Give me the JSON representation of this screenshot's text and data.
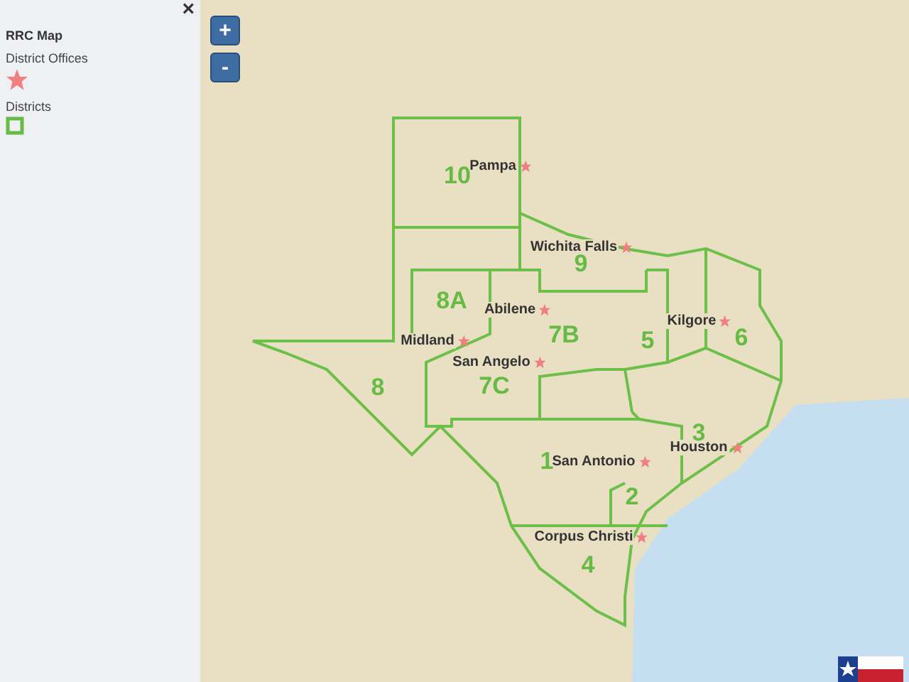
{
  "legend": {
    "close": "×",
    "title": "RRC Map",
    "items": [
      {
        "kind": "star",
        "label": "District Offices"
      },
      {
        "kind": "square",
        "label": "Districts"
      }
    ]
  },
  "zoom": {
    "in": "+",
    "out": "-"
  },
  "map": {
    "districts": [
      "10",
      "8A",
      "9",
      "7B",
      "5",
      "6",
      "8",
      "7C",
      "1",
      "3",
      "2",
      "4"
    ],
    "offices": [
      "Pampa",
      "Wichita Falls",
      "Abilene",
      "Midland",
      "San Angelo",
      "Kilgore",
      "Houston",
      "San Antonio",
      "Corpus Christi"
    ]
  }
}
